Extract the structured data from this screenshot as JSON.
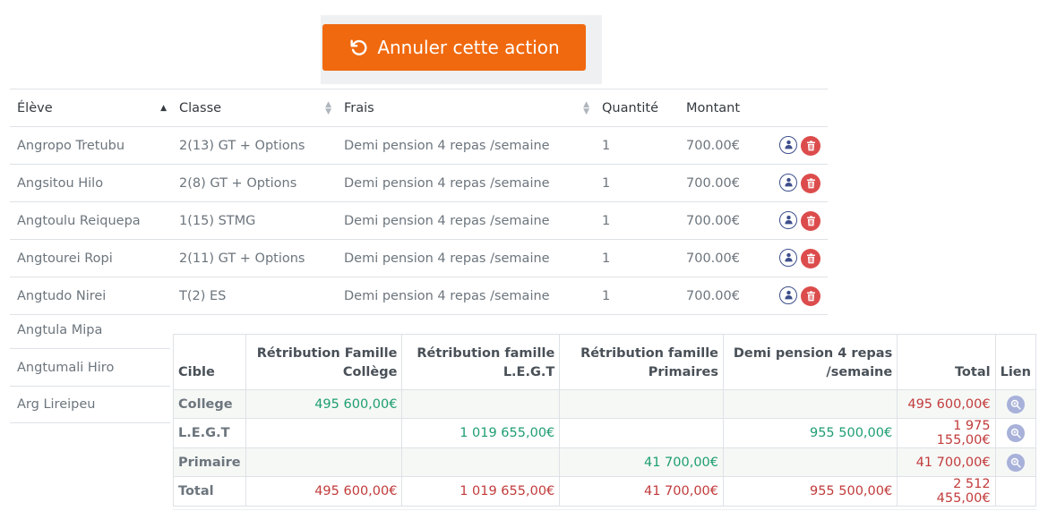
{
  "undo": {
    "label": "Annuler cette action"
  },
  "students": {
    "headers": {
      "eleve": "Élève",
      "classe": "Classe",
      "frais": "Frais",
      "quantite": "Quantité",
      "montant": "Montant"
    },
    "rows": [
      {
        "eleve": "Angropo Tretubu",
        "classe": "2(13) GT + Options",
        "frais": "Demi pension 4 repas /semaine",
        "quantite": "1",
        "montant": "700.00€"
      },
      {
        "eleve": "Angsitou Hilo",
        "classe": "2(8) GT + Options",
        "frais": "Demi pension 4 repas /semaine",
        "quantite": "1",
        "montant": "700.00€"
      },
      {
        "eleve": "Angtoulu Reiquepa",
        "classe": "1(15) STMG",
        "frais": "Demi pension 4 repas /semaine",
        "quantite": "1",
        "montant": "700.00€"
      },
      {
        "eleve": "Angtourei Ropi",
        "classe": "2(11) GT + Options",
        "frais": "Demi pension 4 repas /semaine",
        "quantite": "1",
        "montant": "700.00€"
      },
      {
        "eleve": "Angtudo Nirei",
        "classe": "T(2) ES",
        "frais": "Demi pension 4 repas /semaine",
        "quantite": "1",
        "montant": "700.00€"
      }
    ],
    "partial_rows": [
      "Angtula Mipa",
      "Angtumali Hiro",
      "Arg Lireipeu"
    ]
  },
  "summary": {
    "headers": {
      "cible": "Cible",
      "col1": "Rétribution Famille Collège",
      "col2": "Rétribution famille L.E.G.T",
      "col3": "Rétribution famille Primaires",
      "col4": "Demi pension 4 repas /semaine",
      "total": "Total",
      "lien": "Lien"
    },
    "rows": [
      {
        "cible": "College",
        "col1": "495 600,00€",
        "col2": "",
        "col3": "",
        "col4": "",
        "total": "495 600,00€"
      },
      {
        "cible": "L.E.G.T",
        "col1": "",
        "col2": "1 019 655,00€",
        "col3": "",
        "col4": "955 500,00€",
        "total": "1 975 155,00€"
      },
      {
        "cible": "Primaire",
        "col1": "",
        "col2": "",
        "col3": "41 700,00€",
        "col4": "",
        "total": "41 700,00€"
      }
    ],
    "total_row": {
      "cible": "Total",
      "col1": "495 600,00€",
      "col2": "1 019 655,00€",
      "col3": "41 700,00€",
      "col4": "955 500,00€",
      "total": "2 512 455,00€"
    }
  },
  "colors": {
    "accent": "#f0690f",
    "positive": "#1e9e72",
    "total": "#c23b3b",
    "delete": "#dc4c4c",
    "user": "#3d4f8c"
  },
  "icons": {
    "undo": "undo-icon",
    "user": "user-icon",
    "delete": "trash-icon",
    "link": "zoom-icon",
    "sort": "sort-icon"
  }
}
